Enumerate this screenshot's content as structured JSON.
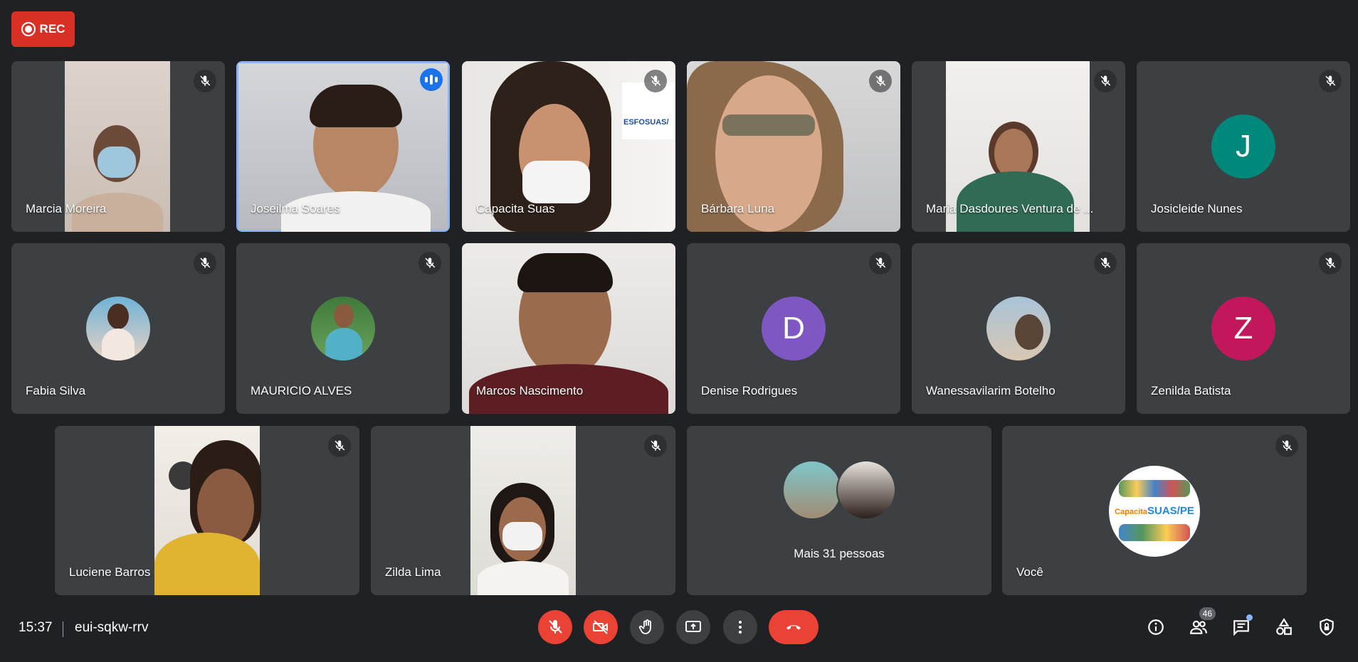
{
  "recording": {
    "label": "REC"
  },
  "participants": [
    {
      "name": "Marcia Moreira"
    },
    {
      "name": "Joseilma Soares"
    },
    {
      "name": "Capacita Suas"
    },
    {
      "name": "Bárbara Luna"
    },
    {
      "name": "Maria Dasdoures Ventura de ..."
    },
    {
      "name": "Josicleide Nunes",
      "initial": "J",
      "color": "#00897b"
    },
    {
      "name": "Fabia Silva"
    },
    {
      "name": "MAURICIO ALVES"
    },
    {
      "name": "Marcos Nascimento"
    },
    {
      "name": "Denise Rodrigues",
      "initial": "D",
      "color": "#7e57c2"
    },
    {
      "name": "Wanessavilarim Botelho"
    },
    {
      "name": "Zenilda Batista",
      "initial": "Z",
      "color": "#c2185b"
    },
    {
      "name": "Luciene Barros"
    },
    {
      "name": "Zilda Lima"
    },
    {
      "name": "Você"
    }
  ],
  "others": {
    "label": "Mais 31 pessoas"
  },
  "banner": {
    "capacita": "Capacita",
    "suas": "SUAS/PE",
    "sign": "ESFOSUAS/"
  },
  "meeting": {
    "time": "15:37",
    "code": "eui-sqkw-rrv"
  },
  "people_count": "46",
  "colors": {
    "background": "#202124",
    "tile": "#3c4043",
    "danger": "#ea4335",
    "accent": "#8ab4f8"
  }
}
